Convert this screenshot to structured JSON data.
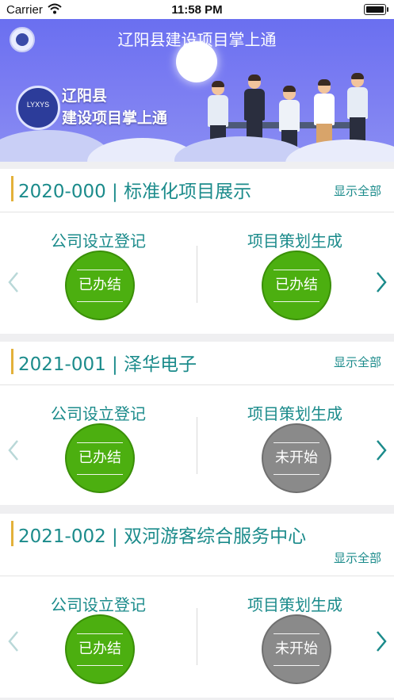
{
  "status_bar": {
    "carrier": "Carrier",
    "time": "11:58 PM"
  },
  "header": {
    "title": "辽阳县建设项目掌上通"
  },
  "banner": {
    "logo_text": "LYXYS",
    "brand_line1": "辽阳县",
    "brand_line2": "建设项目掌上通"
  },
  "projects": [
    {
      "title": "2020-000 | 标准化项目展示",
      "show_all": "显示全部",
      "steps": [
        {
          "name": "公司设立登记",
          "status": "已办结",
          "state": "done"
        },
        {
          "name": "项目策划生成",
          "status": "已办结",
          "state": "done"
        }
      ]
    },
    {
      "title": "2021-001 | 泽华电子",
      "show_all": "显示全部",
      "steps": [
        {
          "name": "公司设立登记",
          "status": "已办结",
          "state": "done"
        },
        {
          "name": "项目策划生成",
          "status": "未开始",
          "state": "pending"
        }
      ]
    },
    {
      "title": "2021-002 | 双河游客综合服务中心",
      "show_all": "显示全部",
      "steps": [
        {
          "name": "公司设立登记",
          "status": "已办结",
          "state": "done"
        },
        {
          "name": "项目策划生成",
          "status": "未开始",
          "state": "pending"
        }
      ]
    }
  ],
  "colors": {
    "accent_teal": "#1b8b8b",
    "title_bar_accent": "#e3b13a",
    "done_green": "#4caf10",
    "pending_gray": "#8a8a8a",
    "banner_purple": "#6a6ff0"
  }
}
